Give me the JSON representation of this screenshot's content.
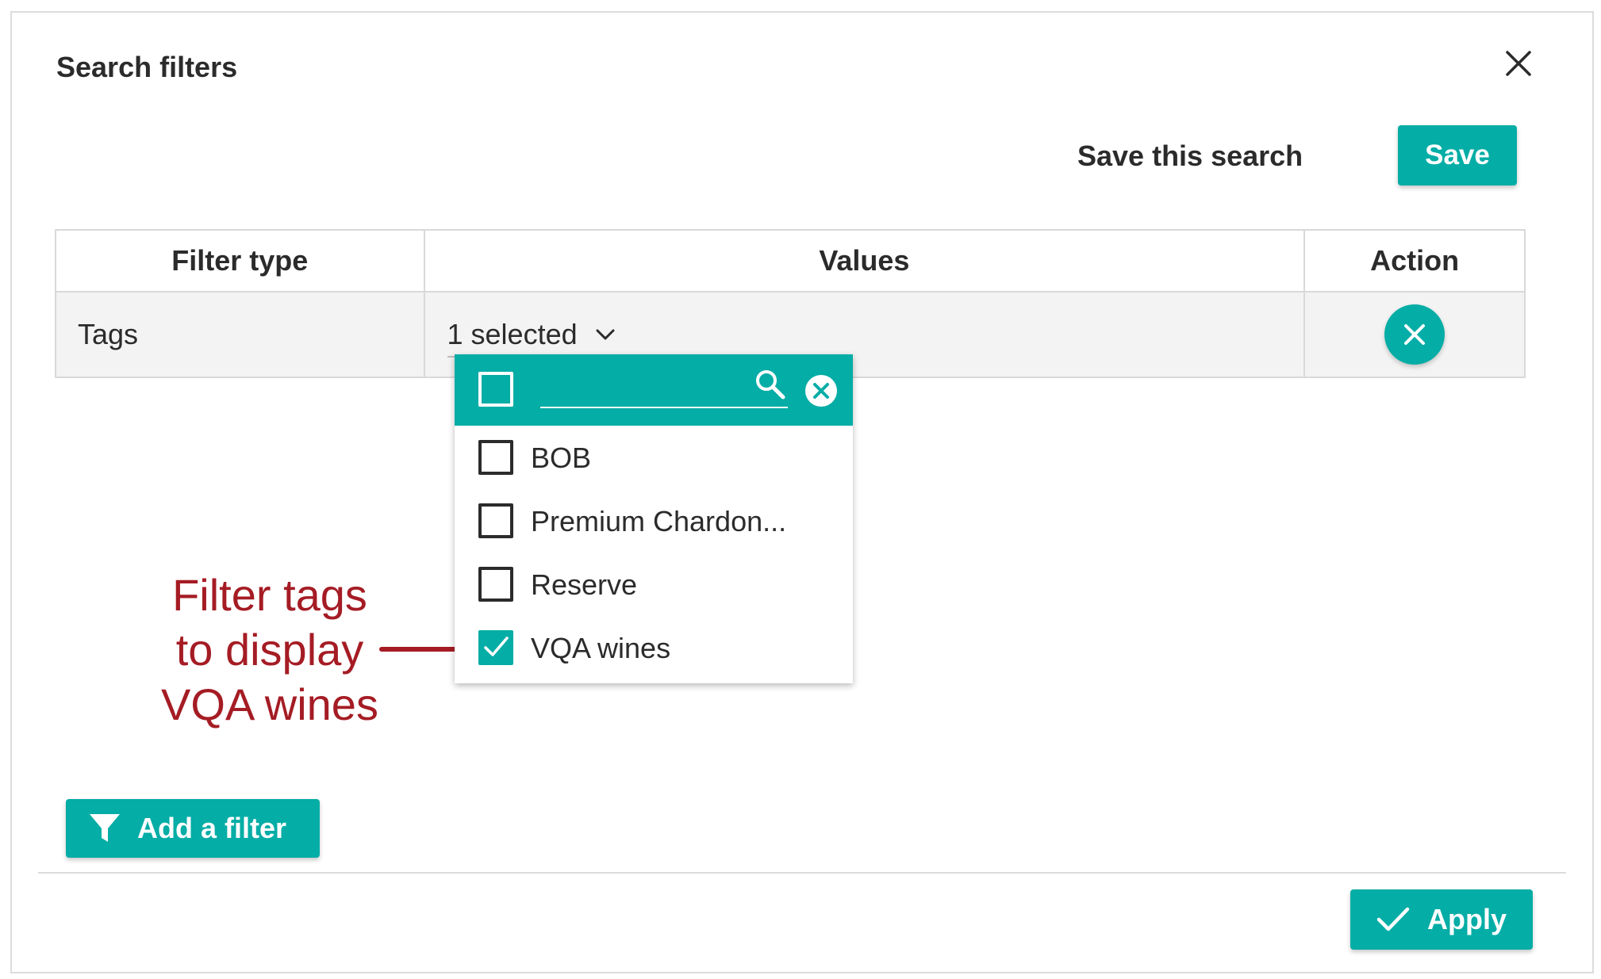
{
  "dialog": {
    "title": "Search filters",
    "close_icon": "close-icon",
    "save_label": "Save this search",
    "save_button": "Save"
  },
  "table": {
    "headers": [
      "Filter type",
      "Values",
      "Action"
    ],
    "rows": [
      {
        "filter_type": "Tags",
        "values_display": "1 selected",
        "action_icon": "remove-circle-icon"
      }
    ]
  },
  "dropdown": {
    "search_placeholder": "",
    "items": [
      {
        "label": "BOB",
        "checked": false
      },
      {
        "label": "Premium Chardon...",
        "checked": false
      },
      {
        "label": "Reserve",
        "checked": false
      },
      {
        "label": "VQA wines",
        "checked": true
      }
    ]
  },
  "annotation": {
    "lines": [
      "Filter tags",
      "to display",
      "VQA wines"
    ],
    "color": "#a51c24"
  },
  "footer": {
    "add_filter_button": "Add a filter",
    "apply_button": "Apply"
  },
  "colors": {
    "accent": "#04ada6",
    "text": "#2b2b2b",
    "annotation": "#a51c24"
  }
}
